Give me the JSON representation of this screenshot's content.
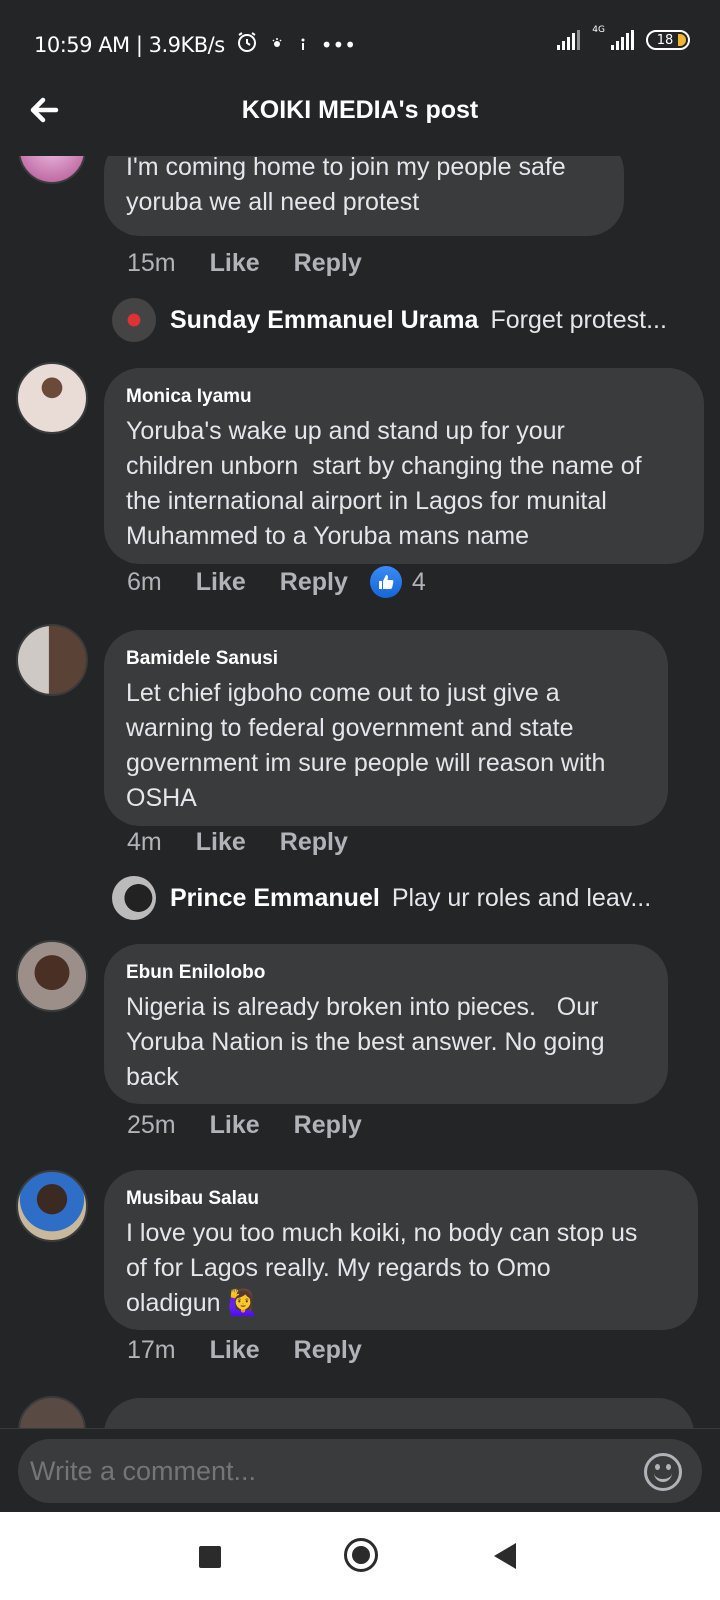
{
  "status_bar": {
    "time_speed": "10:59 AM | 3.9KB/s",
    "icons": [
      "alarm-icon",
      "notification-icon",
      "notification-icon",
      "more-dots-icon"
    ],
    "more": "•••",
    "network": "4G",
    "battery": "18"
  },
  "header": {
    "title": "KOIKI MEDIA's post"
  },
  "comments": [
    {
      "author": "",
      "text": "I'm coming home to join my people safe\nyoruba we all need protest",
      "time": "15m",
      "like": "Like",
      "reply": "Reply",
      "reply_preview": {
        "name": "Sunday Emmanuel Urama",
        "text": "Forget protest..."
      }
    },
    {
      "author": "Monica Iyamu",
      "text": "Yoruba's wake up and stand up for your\nchildren unborn  start by changing the name of\nthe international airport in Lagos for munital\nMuhammed to a Yoruba mans name",
      "time": "6m",
      "like": "Like",
      "reply": "Reply",
      "reactions": "4"
    },
    {
      "author": "Bamidele Sanusi",
      "text": "Let chief igboho come out to just give a\nwarning to federal government and state\ngovernment im sure people will reason with\nOSHA",
      "time": "4m",
      "like": "Like",
      "reply": "Reply",
      "reply_preview": {
        "name": "Prince Emmanuel",
        "text": "Play ur roles and leav..."
      }
    },
    {
      "author": "Ebun Enilolobo",
      "text": "Nigeria is already broken into pieces.   Our\nYoruba Nation is the best answer. No going\nback",
      "time": "25m",
      "like": "Like",
      "reply": "Reply"
    },
    {
      "author": "Musibau Salau",
      "text": "I love you too much koiki, no body can stop us\nof for Lagos really. My regards to Omo\noladigun 🙋‍♀️",
      "time": "17m",
      "like": "Like",
      "reply": "Reply"
    }
  ],
  "composer": {
    "placeholder": "Write a comment..."
  },
  "colors": {
    "background": "#242526",
    "bubble": "#3a3b3c",
    "secondary_text": "#b0b3b8",
    "like_blue": "#1877f2",
    "battery_fill": "#f2b632"
  }
}
